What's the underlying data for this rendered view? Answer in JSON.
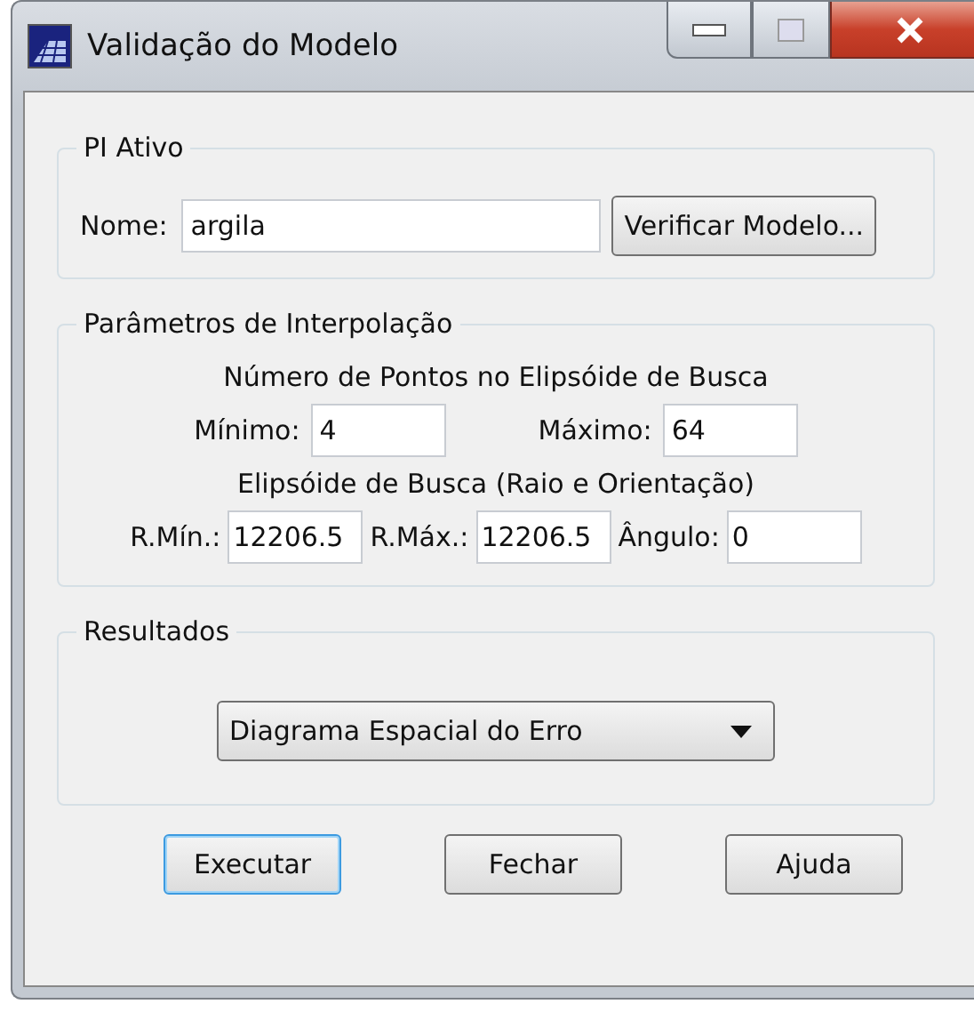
{
  "window": {
    "title": "Validação do Modelo"
  },
  "pi_ativo": {
    "title": "PI Ativo",
    "name_label": "Nome:",
    "name_value": "argila",
    "verify_button": "Verificar Modelo..."
  },
  "parametros": {
    "title": "Parâmetros de Interpolação",
    "points_heading": "Número de Pontos no Elipsóide de Busca",
    "points_fields": [
      {
        "label": "Mínimo:",
        "value": "4"
      },
      {
        "label": "Máximo:",
        "value": "64"
      }
    ],
    "ellipse_heading": "Elipsóide de Busca (Raio e Orientação)",
    "ellipse_fields": [
      {
        "label": "R.Mín.:",
        "value": "12206.5"
      },
      {
        "label": "R.Máx.:",
        "value": "12206.5"
      },
      {
        "label": "Ângulo:",
        "value": "0"
      }
    ]
  },
  "resultados": {
    "title": "Resultados",
    "dropdown": "Diagrama Espacial do Erro"
  },
  "buttons": [
    {
      "label": "Executar",
      "focused": true
    },
    {
      "label": "Fechar",
      "focused": false
    },
    {
      "label": "Ajuda",
      "focused": false
    }
  ]
}
